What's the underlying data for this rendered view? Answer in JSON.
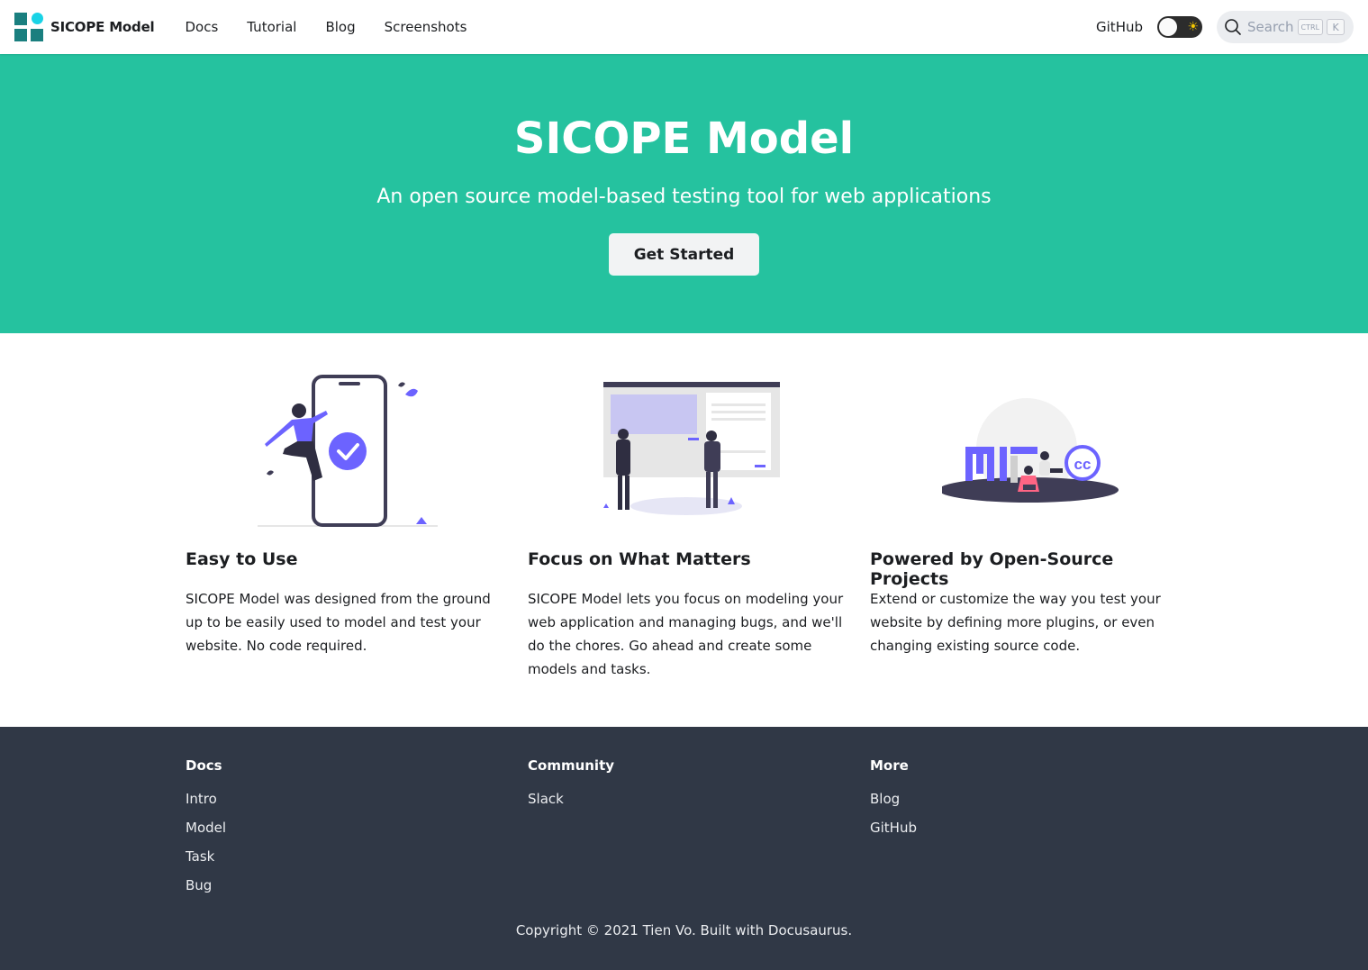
{
  "nav": {
    "brand": "SICOPE Model",
    "links": [
      "Docs",
      "Tutorial",
      "Blog",
      "Screenshots"
    ],
    "github": "GitHub",
    "search_placeholder": "Search",
    "search_keys": [
      "CTRL",
      "K"
    ]
  },
  "hero": {
    "title": "SICOPE Model",
    "subtitle": "An open source model-based testing tool for web applications",
    "cta": "Get Started"
  },
  "features": [
    {
      "title": "Easy to Use",
      "text": "SICOPE Model was designed from the ground up to be easily used to model and test your website. No code required."
    },
    {
      "title": "Focus on What Matters",
      "text": "SICOPE Model lets you focus on modeling your web application and managing bugs, and we'll do the chores. Go ahead and create some models and tasks."
    },
    {
      "title": "Powered by Open-Source Projects",
      "text": "Extend or customize the way you test your website by defining more plugins, or even changing existing source code."
    }
  ],
  "footer": {
    "columns": [
      {
        "title": "Docs",
        "links": [
          "Intro",
          "Model",
          "Task",
          "Bug"
        ]
      },
      {
        "title": "Community",
        "links": [
          "Slack"
        ]
      },
      {
        "title": "More",
        "links": [
          "Blog",
          "GitHub"
        ]
      }
    ],
    "copyright": "Copyright © 2021 Tien Vo. Built with Docusaurus."
  },
  "colors": {
    "hero_bg": "#25c29f",
    "footer_bg": "#303846",
    "illustration_accent": "#6c63ff"
  }
}
